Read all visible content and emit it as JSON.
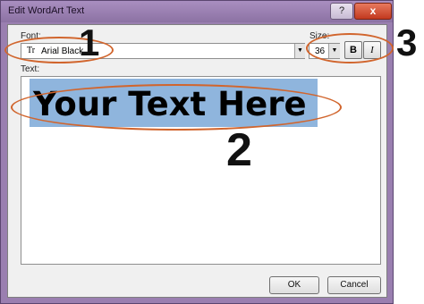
{
  "window": {
    "title": "Edit WordArt Text",
    "help_label": "?",
    "close_label": "x"
  },
  "font": {
    "label": "Font:",
    "value": "Arial Black",
    "icon_glyph": "Tr"
  },
  "size": {
    "label": "Size:",
    "value": "36"
  },
  "format": {
    "bold_label": "B",
    "italic_label": "I"
  },
  "text": {
    "label": "Text:",
    "value": "Your Text Here"
  },
  "buttons": {
    "ok": "OK",
    "cancel": "Cancel"
  },
  "callouts": [
    "1",
    "2",
    "3"
  ],
  "colors": {
    "callout_ring": "#d1652d",
    "selection": "#8fb5dd",
    "titlebar": "#9a7fb0"
  }
}
